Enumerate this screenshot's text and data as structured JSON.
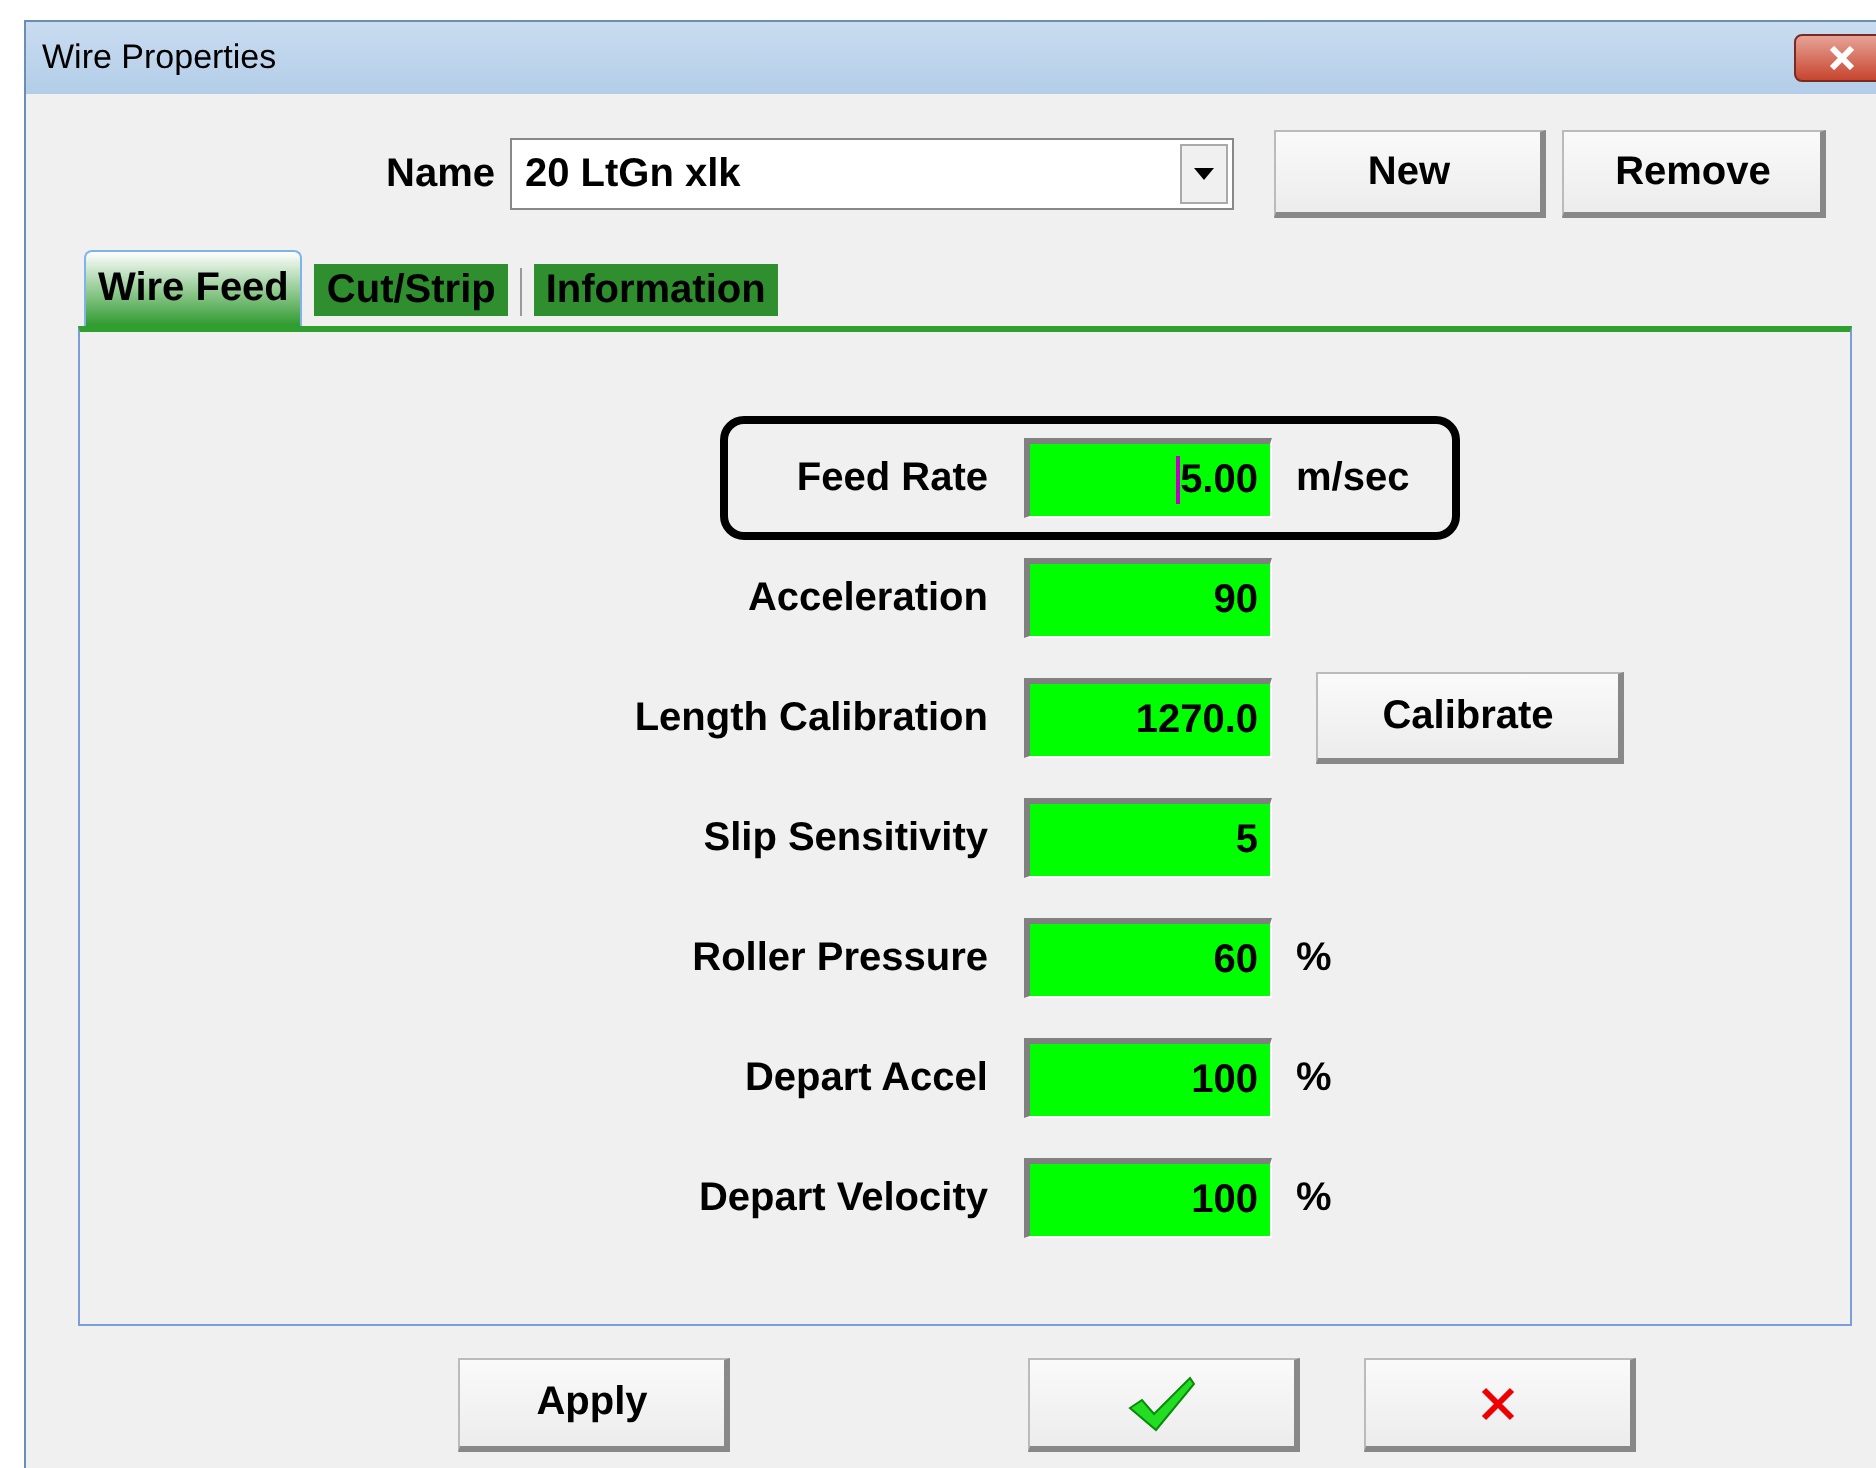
{
  "window": {
    "title": "Wire Properties"
  },
  "name_field": {
    "label": "Name",
    "value": "20 LtGn xlk"
  },
  "top_buttons": [
    "New",
    "Remove"
  ],
  "tabs": [
    {
      "label": "Wire Feed",
      "selected": true
    },
    {
      "label": "Cut/Strip",
      "selected": false
    },
    {
      "label": "Information",
      "selected": false
    }
  ],
  "fields": [
    {
      "label": "Feed Rate",
      "value": "5.00",
      "unit": "m/sec",
      "highlighted": true,
      "focused": true
    },
    {
      "label": "Acceleration",
      "value": "90",
      "highlighted": false,
      "focused": false
    },
    {
      "label": "Length Calibration",
      "value": "1270.0",
      "button": "Calibrate",
      "highlighted": false,
      "focused": false
    },
    {
      "label": "Slip Sensitivity",
      "value": "5",
      "highlighted": false,
      "focused": false
    },
    {
      "label": "Roller Pressure",
      "value": "60",
      "unit": "%",
      "highlighted": false,
      "focused": false
    },
    {
      "label": "Depart Accel",
      "value": "100",
      "unit": "%",
      "highlighted": false,
      "focused": false
    },
    {
      "label": "Depart Velocity",
      "value": "100",
      "unit": "%",
      "highlighted": false,
      "focused": false
    }
  ],
  "bottom_buttons": [
    {
      "kind": "text",
      "label": "Apply"
    },
    {
      "kind": "ok"
    },
    {
      "kind": "cancel"
    }
  ]
}
